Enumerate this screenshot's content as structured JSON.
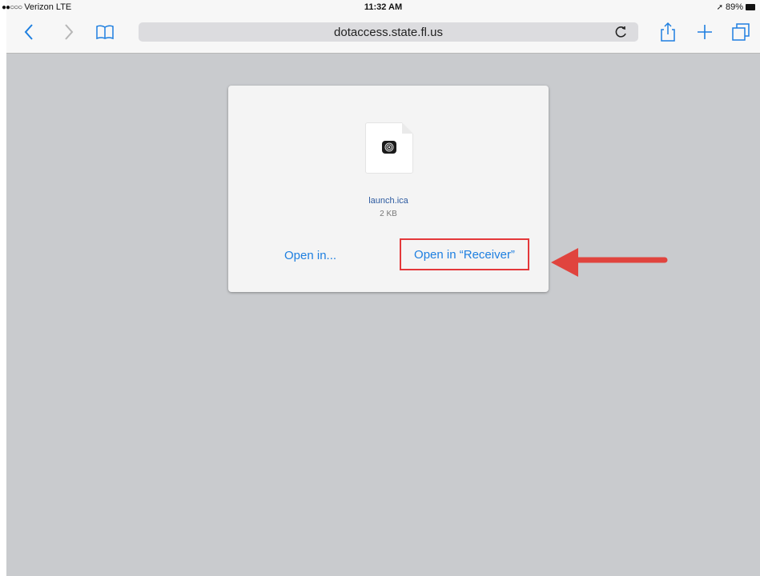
{
  "status_bar": {
    "signal_dots": "●●○○○",
    "carrier": "Verizon",
    "network": "LTE",
    "time": "11:32 AM",
    "battery_percent": "89%"
  },
  "toolbar": {
    "url": "dotaccess.state.fl.us"
  },
  "dialog": {
    "file_name": "launch.ica",
    "file_size": "2 KB",
    "open_in_label": "Open in...",
    "open_receiver_label": "Open in “Receiver”"
  },
  "colors": {
    "link_blue": "#1e7fe0",
    "highlight_red": "#e4383a",
    "page_background": "#c9cbce"
  },
  "icons": [
    "back-icon",
    "forward-icon",
    "bookmarks-icon",
    "reload-icon",
    "share-icon",
    "new-tab-icon",
    "tabs-icon",
    "file-icon",
    "receiver-app-icon",
    "callout-arrow-icon"
  ]
}
